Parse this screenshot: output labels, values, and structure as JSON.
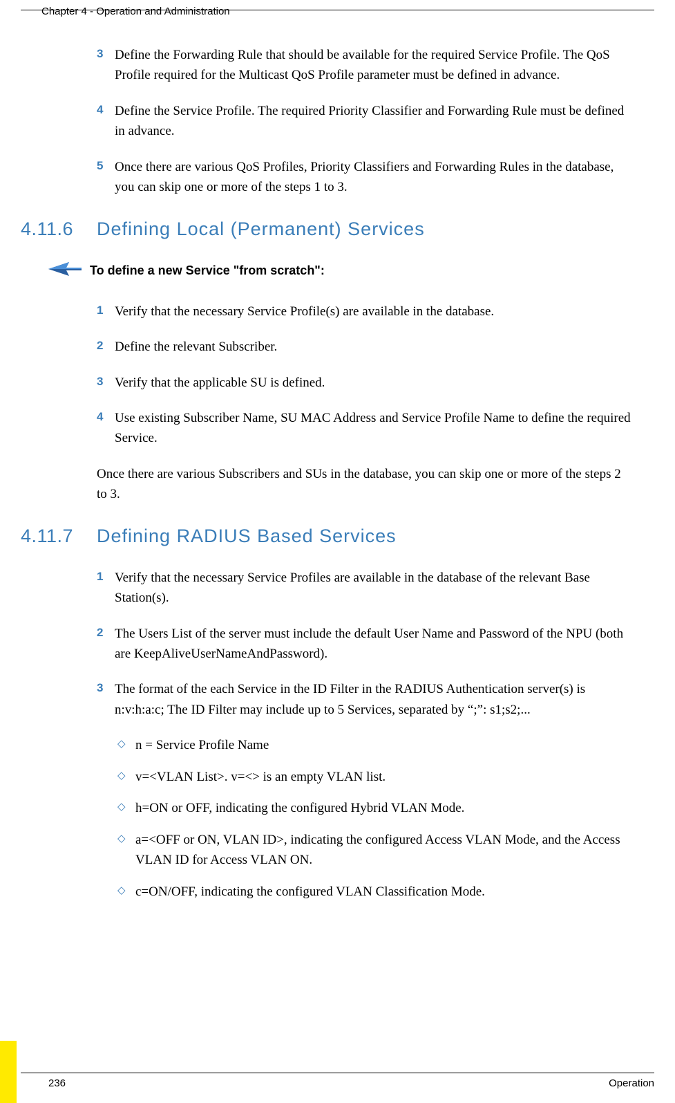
{
  "header": {
    "chapter": "Chapter 4 - Operation and Administration"
  },
  "list1": {
    "i3": {
      "num": "3",
      "text": "Define the Forwarding Rule that should be available for the required Service Profile. The QoS Profile required for the Multicast QoS Profile parameter must be defined in advance."
    },
    "i4": {
      "num": "4",
      "text": "Define the Service Profile. The required Priority Classifier and Forwarding Rule must be defined in advance."
    },
    "i5": {
      "num": "5",
      "text": "Once there are various QoS Profiles, Priority Classifiers and Forwarding Rules in the database, you can skip one or more of the steps 1 to 3."
    }
  },
  "sec6": {
    "num": "4.11.6",
    "title": "Defining Local (Permanent) Services",
    "callout": "To define a new Service \"from scratch\":",
    "i1": {
      "num": "1",
      "text": "Verify that the necessary Service Profile(s) are available in the database."
    },
    "i2": {
      "num": "2",
      "text": "Define the relevant Subscriber."
    },
    "i3": {
      "num": "3",
      "text": "Verify that the applicable SU is defined."
    },
    "i4": {
      "num": "4",
      "text": "Use existing Subscriber Name, SU MAC Address and Service Profile Name to define the required Service."
    },
    "para": "Once there are various Subscribers and SUs in the database, you can skip one or more of the steps 2 to 3."
  },
  "sec7": {
    "num": "4.11.7",
    "title": "Defining RADIUS Based Services",
    "i1": {
      "num": "1",
      "text": "Verify that the necessary Service Profiles are available in the database of the relevant Base Station(s)."
    },
    "i2": {
      "num": "2",
      "text": "The Users List of the server must include the default User Name and Password of the NPU (both are KeepAliveUserNameAndPassword)."
    },
    "i3": {
      "num": "3",
      "text": "The format of the each Service in the ID Filter in the RADIUS Authentication server(s) is n:v:h:a:c; The ID Filter may include up to 5 Services, separated by “;”: s1;s2;..."
    },
    "sub": {
      "a": "n = Service Profile Name",
      "b": "v=<VLAN List>. v=<> is an empty VLAN list.",
      "c": "h=ON or OFF, indicating the configured Hybrid VLAN Mode.",
      "d": "a=<OFF or ON, VLAN ID>, indicating the configured Access VLAN Mode, and the Access VLAN ID for Access VLAN ON.",
      "e": "c=ON/OFF, indicating the configured VLAN Classification Mode."
    }
  },
  "footer": {
    "page": "236",
    "label": "Operation"
  }
}
